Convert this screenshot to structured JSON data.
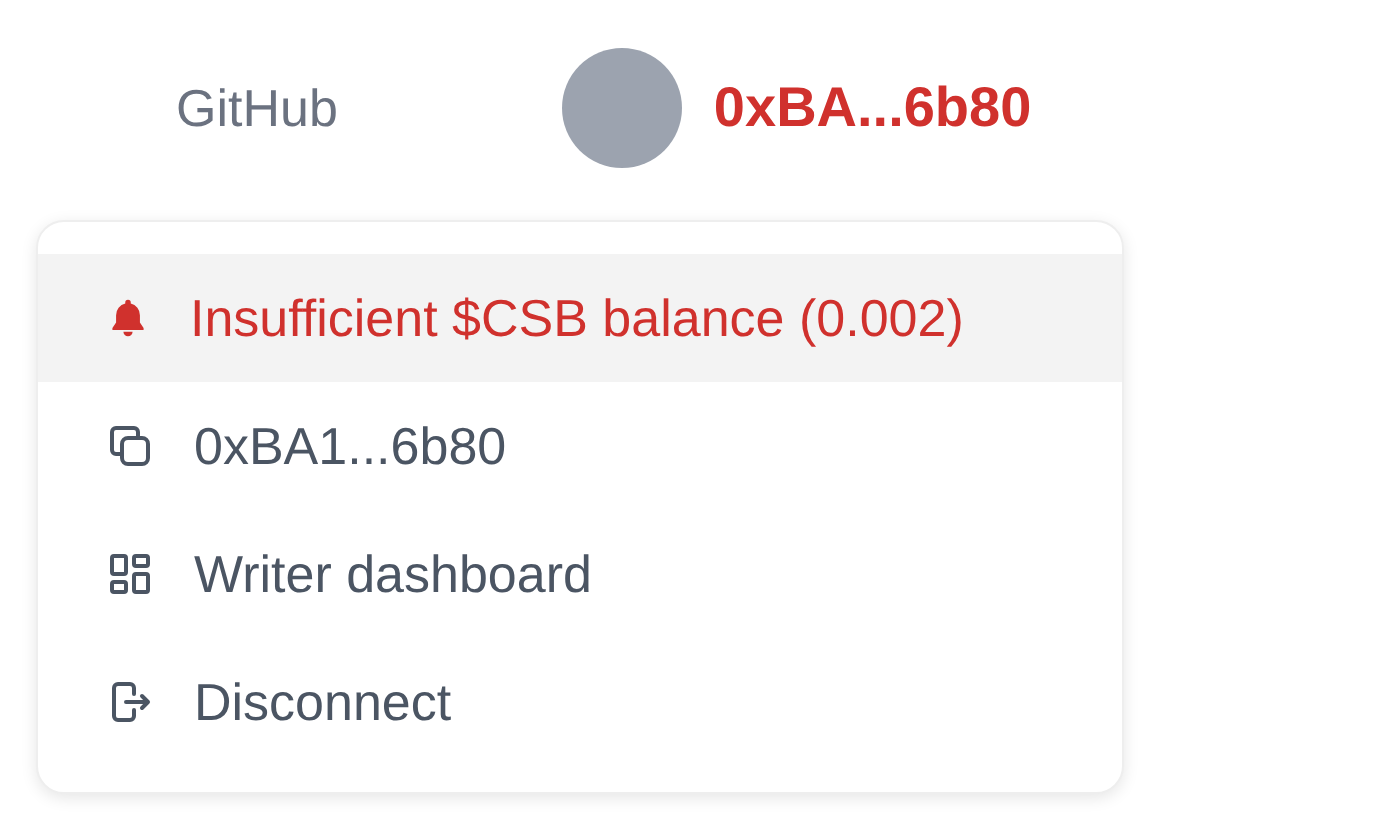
{
  "header": {
    "link": "GitHub",
    "account": "0xBA...6b80"
  },
  "menu": {
    "items": [
      {
        "kind": "warning",
        "label": "Insufficient $CSB balance (0.002)"
      },
      {
        "kind": "copy",
        "label": "0xBA1...6b80"
      },
      {
        "kind": "dashboard",
        "label": "Writer dashboard"
      },
      {
        "kind": "disconnect",
        "label": "Disconnect"
      }
    ]
  }
}
